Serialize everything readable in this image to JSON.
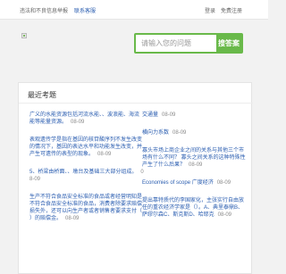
{
  "topbar": {
    "notice": "违法和不良信息举报",
    "contact": "联系客服",
    "login": "登录",
    "register": "免费注册"
  },
  "search": {
    "placeholder": "请输入您的问题",
    "button_label": "搜答案"
  },
  "recent": {
    "title": "最近考题",
    "left_items": [
      {
        "text": "广义的水能资源包括河流水能、、波浪能、海流能等能量资源。",
        "date": "08-09"
      },
      {
        "text": "表观遗传学是指在基因的核苷酸序列不发生改变的情况下，基因的表达水平和功能发生改变，并产生可遗传的表型的现象。",
        "date": "08-09"
      },
      {
        "text": "5、桥梁由桥面、、墩台及基础三大部分组成。",
        "date": "08-09"
      },
      {
        "text": "生产不符合食品安全标准的食品或者经营明知是不符合食品安全标准的食品，消费者除要求赔偿损失外，还可以向生产者或者销售者要求支付（ ）的赔偿金。",
        "date": "08-09"
      }
    ],
    "right_items": [
      {
        "text": "交通量",
        "date": "08-09"
      },
      {
        "text": "横向力系数",
        "date": "08-09"
      },
      {
        "text": "寡头市场上商企业之间的关系与其他三个市场有什么不同？ 寡头之间关系的这种特殊性产生了什么后果？",
        "date": "08-09"
      },
      {
        "text": "Economies of scope 广度经济",
        "date": "08-09"
      },
      {
        "text": "提出靠特质代的李国家化，主张实行自由放任的重农经济学家是（）。A、典里泰鼎B、萨缪尔森C、斯克斯D、哈耶克",
        "date": "08-09"
      }
    ]
  }
}
